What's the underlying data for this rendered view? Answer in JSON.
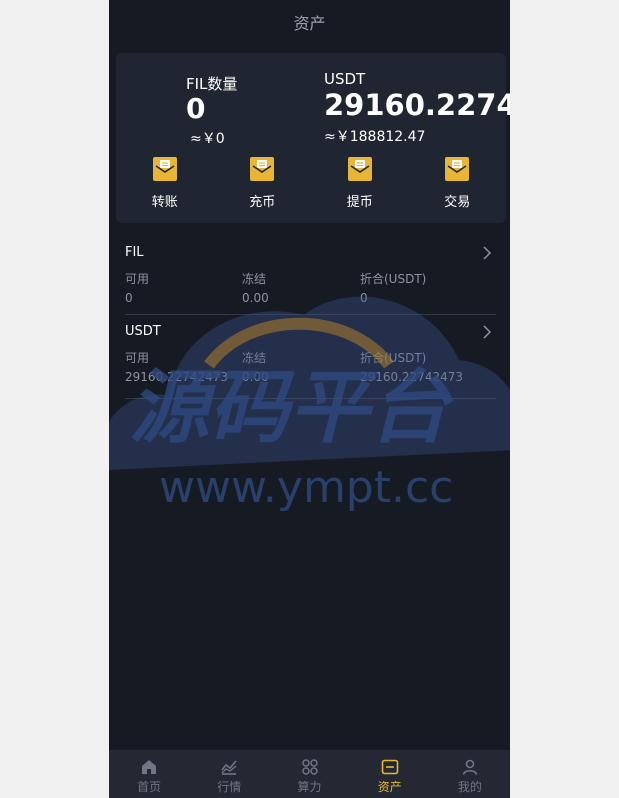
{
  "header": {
    "title": "资产"
  },
  "balances": {
    "fil": {
      "label": "FIL数量",
      "amount": "0",
      "cny": "≈￥0"
    },
    "usdt": {
      "label": "USDT",
      "amount": "29160.2274",
      "cny": "≈￥188812.47"
    }
  },
  "actions": [
    {
      "label": "转账",
      "icon": "transfer-icon"
    },
    {
      "label": "充币",
      "icon": "deposit-icon"
    },
    {
      "label": "提币",
      "icon": "withdraw-icon"
    },
    {
      "label": "交易",
      "icon": "trade-icon"
    }
  ],
  "assets": [
    {
      "name": "FIL",
      "available_label": "可用",
      "available": "0",
      "frozen_label": "冻结",
      "frozen": "0.00",
      "converted_label": "折合(USDT)",
      "converted": "0"
    },
    {
      "name": "USDT",
      "available_label": "可用",
      "available": "29160.22742473",
      "frozen_label": "冻结",
      "frozen": "0.00",
      "converted_label": "折合(USDT)",
      "converted": "29160.22742473"
    }
  ],
  "watermark": {
    "title": "源码平台",
    "url": "www.ympt.cc"
  },
  "nav": [
    {
      "label": "首页",
      "icon": "home-icon"
    },
    {
      "label": "行情",
      "icon": "chart-icon"
    },
    {
      "label": "算力",
      "icon": "hashrate-icon"
    },
    {
      "label": "资产",
      "icon": "wallet-icon",
      "active": true
    },
    {
      "label": "我的",
      "icon": "user-icon"
    }
  ],
  "colors": {
    "accent": "#e8b634",
    "background": "#161a22",
    "card": "#202631"
  }
}
